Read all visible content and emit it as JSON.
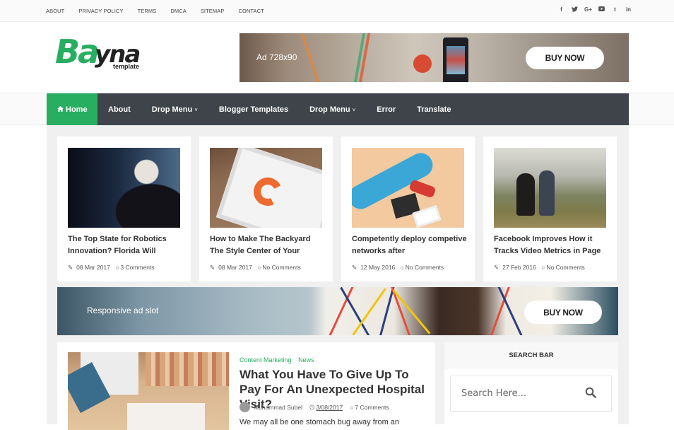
{
  "topbar": {
    "links": [
      "ABOUT",
      "PRIVACY POLICY",
      "TERMS",
      "DMCA",
      "SITEMAP",
      "CONTACT"
    ],
    "social": [
      {
        "icon": "facebook-icon",
        "glyph": "f"
      },
      {
        "icon": "twitter-icon",
        "glyph": "ᵛ"
      },
      {
        "icon": "google-plus-icon",
        "glyph": "G+"
      },
      {
        "icon": "youtube-icon",
        "glyph": "▣"
      },
      {
        "icon": "tumblr-icon",
        "glyph": "t"
      },
      {
        "icon": "linkedin-icon",
        "glyph": "in"
      }
    ]
  },
  "header": {
    "logo": {
      "primary": "Ba",
      "secondary": "yna",
      "tagline": "template"
    },
    "ad": {
      "label": "Ad 728x90",
      "button": "BUY NOW"
    }
  },
  "nav": {
    "items": [
      {
        "label": "Home",
        "icon": "home-icon",
        "active": true
      },
      {
        "label": "About"
      },
      {
        "label": "Drop Menu",
        "dropdown": true
      },
      {
        "label": "Blogger Templates"
      },
      {
        "label": "Drop Menu",
        "dropdown": true
      },
      {
        "label": "Error"
      },
      {
        "label": "Translate"
      }
    ],
    "home_glyph": "⌂",
    "chevron_glyph": "˅",
    "colors": {
      "bar": "#3e444a",
      "active": "#27ae60"
    }
  },
  "featured": [
    {
      "title": "The Top State for Robotics Innovation? Florida Will",
      "date": "08 Mar 2017",
      "comments": "3 Comments"
    },
    {
      "title": "How to Make The Backyard The Style Center of Your",
      "date": "08 Mar 2017",
      "comments": "No Comments"
    },
    {
      "title": "Competently deploy competive networks after",
      "date": "12 May 2016",
      "comments": "No Comments"
    },
    {
      "title": "Facebook Improves How it Tracks Video Metrics in Page",
      "date": "27 Feb 2016",
      "comments": "No Comments"
    }
  ],
  "meta_icons": {
    "edit": "✎",
    "comment": "○",
    "clock": "◷"
  },
  "ad_mid": {
    "label": "Responsive ad slot",
    "button": "BUY NOW"
  },
  "post": {
    "categories": [
      "Content Marketing",
      "News"
    ],
    "title": "What You Have To Give Up To Pay For An Unexpected Hospital Visit?",
    "author": "Muhammad Subel",
    "date": "3/08/2017",
    "comments": "7 Comments",
    "excerpt": "We may all be one stomach bug away from an"
  },
  "sidebar": {
    "search_widget": {
      "title": "SEARCH BAR",
      "placeholder": "Search Here..."
    }
  },
  "colors": {
    "accent": "#27ae60",
    "nav": "#3e444a",
    "background": "#f0f0f0"
  }
}
